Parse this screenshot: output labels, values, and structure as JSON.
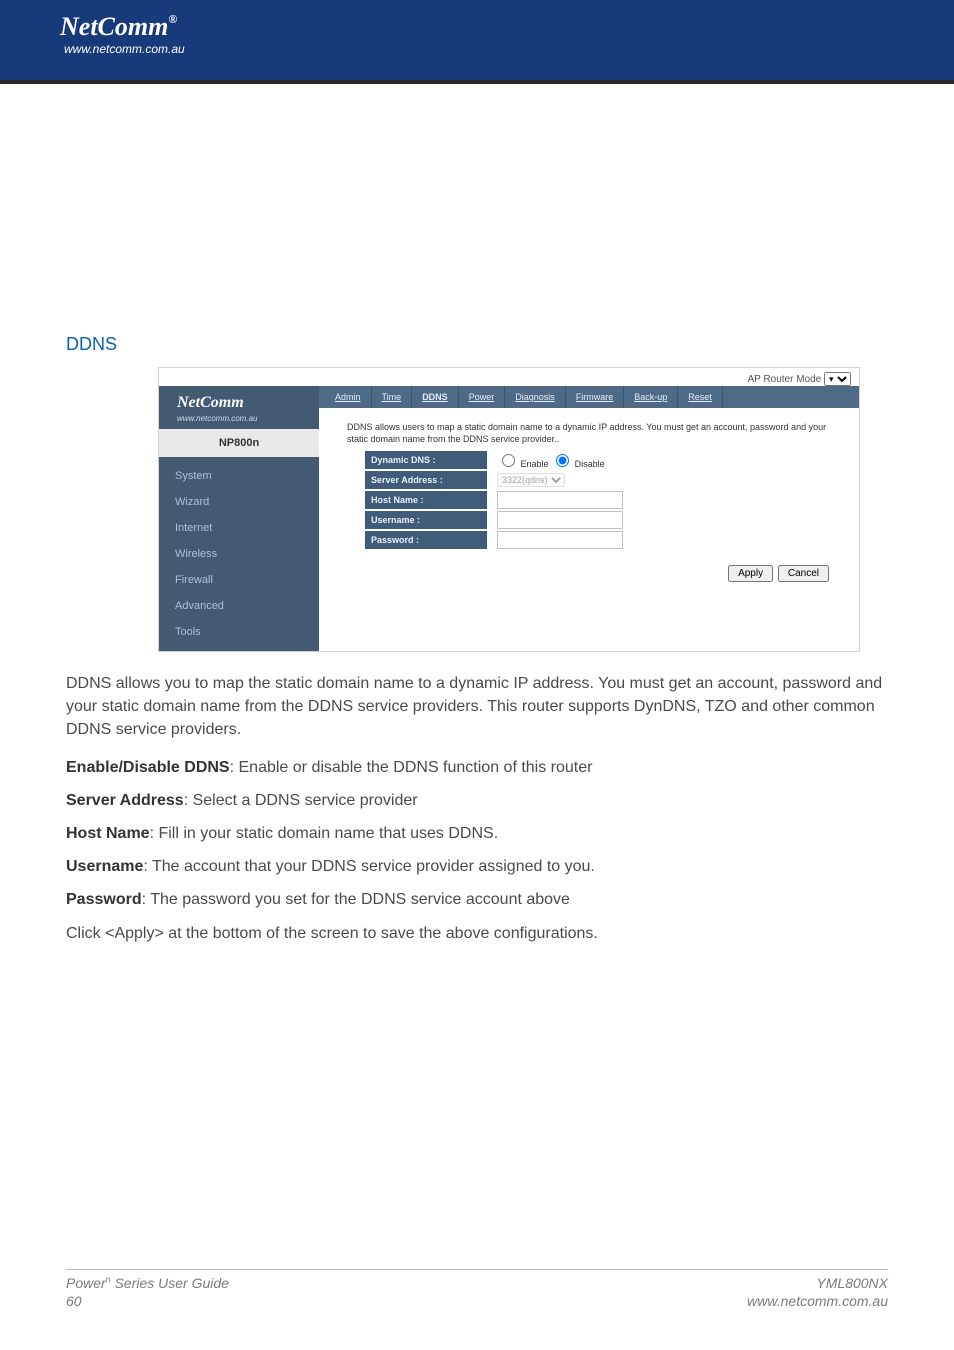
{
  "brand": {
    "logo_text": "NetComm",
    "reg": "®",
    "url": "www.netcomm.com.au"
  },
  "section_title": "DDNS",
  "screenshot": {
    "mode_label": "AP Router Mode",
    "sidebar": {
      "logo": "NetComm",
      "url": "www.netcomm.com.au",
      "model": "NP800n",
      "nav": [
        "System",
        "Wizard",
        "Internet",
        "Wireless",
        "Firewall",
        "Advanced",
        "Tools"
      ]
    },
    "tabs": [
      "Admin",
      "Time",
      "DDNS",
      "Power",
      "Diagnosis",
      "Firmware",
      "Back-up",
      "Reset"
    ],
    "active_tab": "DDNS",
    "desc": "DDNS allows users to map a static domain name to a dynamic IP address. You must get an account, password and your static domain name from the DDNS service provider..",
    "form": {
      "dynamic_dns_label": "Dynamic DNS :",
      "enable_label": "Enable",
      "disable_label": "Disable",
      "server_address_label": "Server Address :",
      "server_address_value": "3322(qdns)",
      "host_name_label": "Host Name :",
      "username_label": "Username :",
      "password_label": "Password :"
    },
    "apply_label": "Apply",
    "cancel_label": "Cancel"
  },
  "body": {
    "intro": "DDNS allows you to map the static domain name to a dynamic IP address. You must get an account, password and your static domain name from the DDNS service providers. This router supports DynDNS, TZO and other common DDNS service providers.",
    "items": [
      {
        "term": "Enable/Disable DDNS",
        "desc": ": Enable or disable the DDNS function of this router"
      },
      {
        "term": "Server Address",
        "desc": ": Select a DDNS service provider"
      },
      {
        "term": "Host Name",
        "desc": ": Fill in your static domain name that uses DDNS."
      },
      {
        "term": "Username",
        "desc": ": The account that your DDNS service provider assigned to you."
      },
      {
        "term": "Password",
        "desc": ": The password you set for the DDNS service account above"
      }
    ],
    "apply_note": "Click <Apply> at the bottom of the screen to save the above configurations."
  },
  "footer": {
    "left_line1_pre": "Power",
    "left_line1_sup": "n",
    "left_line1_post": " Series User Guide",
    "left_line2": "60",
    "right_line1": "YML800NX",
    "right_line2": "www.netcomm.com.au"
  }
}
